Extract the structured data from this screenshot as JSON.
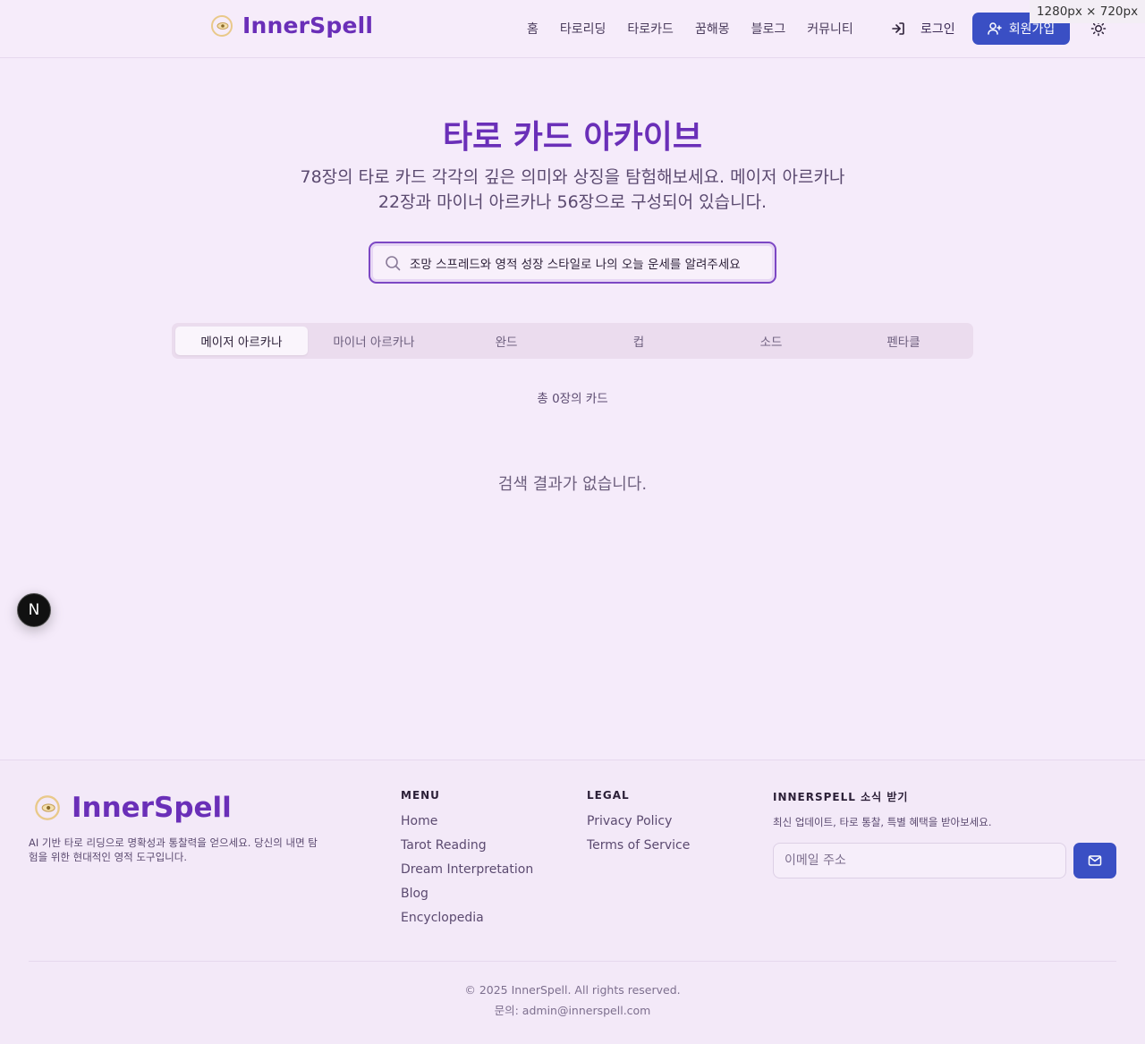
{
  "header": {
    "brand": "InnerSpell",
    "nav": [
      "홈",
      "타로리딩",
      "타로카드",
      "꿈해몽",
      "블로그",
      "커뮤니티"
    ],
    "login_label": "로그인",
    "signup_label": "회원가입",
    "size_badge": "1280px × 720px"
  },
  "hero": {
    "title": "타로 카드 아카이브",
    "subtitle_line1": "78장의 타로 카드 각각의 깊은 의미와 상징을 탐험해보세요. 메이저 아르카나",
    "subtitle_line2": "22장과 마이너 아르카나 56장으로 구성되어 있습니다.",
    "search_value": "조망 스프레드와 영적 성장 스타일로 나의 오늘 운세를 알려주세요"
  },
  "tabs": [
    "메이저 아르카나",
    "마이너 아르카나",
    "완드",
    "컵",
    "소드",
    "펜타클"
  ],
  "active_tab": "메이저 아르카나",
  "results": {
    "count_label": "총 0장의 카드",
    "empty_message": "검색 결과가 없습니다."
  },
  "dev_badge": "N",
  "footer": {
    "brand": "InnerSpell",
    "description": "AI 기반 타로 리딩으로 명확성과 통찰력을 얻으세요. 당신의 내면 탐험을 위한 현대적인 영적 도구입니다.",
    "menu_heading": "MENU",
    "menu_links": [
      "Home",
      "Tarot Reading",
      "Dream Interpretation",
      "Blog",
      "Encyclopedia"
    ],
    "legal_heading": "LEGAL",
    "legal_links": [
      "Privacy Policy",
      "Terms of Service"
    ],
    "newsletter_heading": "INNERSPELL 소식 받기",
    "newsletter_desc": "최신 업데이트, 타로 통찰, 특별 혜택을 받아보세요.",
    "email_placeholder": "이메일 주소",
    "copyright": "© 2025 InnerSpell. All rights reserved.",
    "contact": "문의: admin@innerspell.com"
  },
  "colors": {
    "brand_purple": "#6a2fb8",
    "button_blue": "#3a4fc4",
    "background": "#f5ebfa"
  }
}
